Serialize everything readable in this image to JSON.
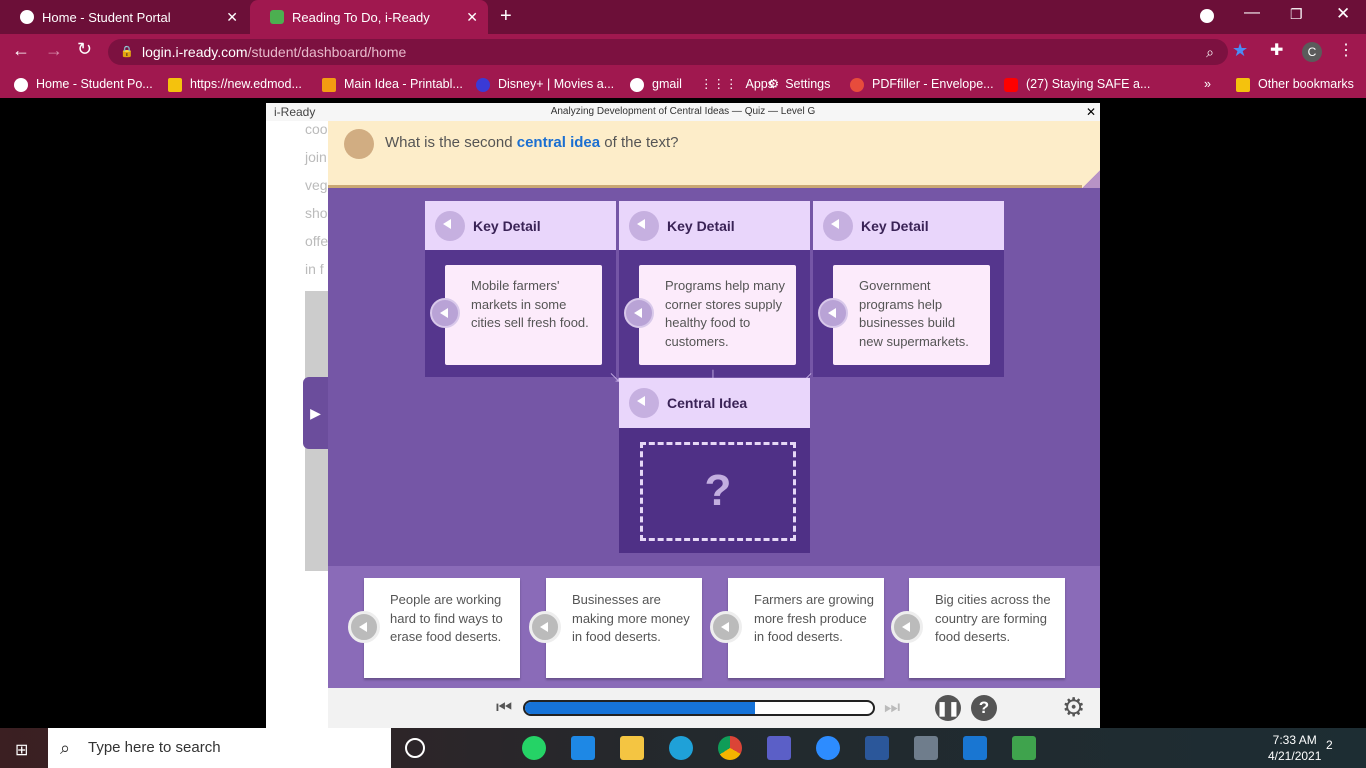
{
  "browser": {
    "tabs": [
      {
        "label": "Home - Student Portal"
      },
      {
        "label": "Reading To Do, i-Ready"
      }
    ],
    "url_host": "login.i-ready.com",
    "url_path": "/student/dashboard/home",
    "bookmarks": [
      "Home - Student Po...",
      "https://new.edmod...",
      "Main Idea - Printabl...",
      "Disney+ | Movies a...",
      "gmail",
      "Apps",
      "Settings",
      "PDFfiller - Envelope...",
      "(27) Staying SAFE a..."
    ],
    "more": "»",
    "other": "Other bookmarks",
    "profile": "C"
  },
  "app": {
    "logo": "i-Ready",
    "title": "Analyzing Development of Central Ideas — Quiz — Level G",
    "close": "✕",
    "left_text": [
      "coo",
      "join",
      "veg",
      "sho",
      "offe",
      "in f"
    ],
    "question_pre": "What is the second ",
    "question_key": "central idea",
    "question_post": " of the text?",
    "key_details": [
      {
        "header": "Key Detail",
        "text": "Mobile farmers' markets in some cities sell fresh food."
      },
      {
        "header": "Key Detail",
        "text": "Programs help many corner stores supply healthy food to customers."
      },
      {
        "header": "Key Detail",
        "text": "Government programs help businesses build new supermarkets."
      }
    ],
    "central_header": "Central Idea",
    "central_placeholder": "?",
    "answers": [
      "People are working hard to find ways to erase food deserts.",
      "Businesses are making more money in food deserts.",
      "Farmers are growing more fresh produce in food deserts.",
      "Big cities across the country are forming food deserts."
    ],
    "progress": 0.66
  },
  "taskbar": {
    "search": "Type here to search",
    "time": "7:33 AM",
    "date": "4/21/2021",
    "notifications": "2"
  }
}
